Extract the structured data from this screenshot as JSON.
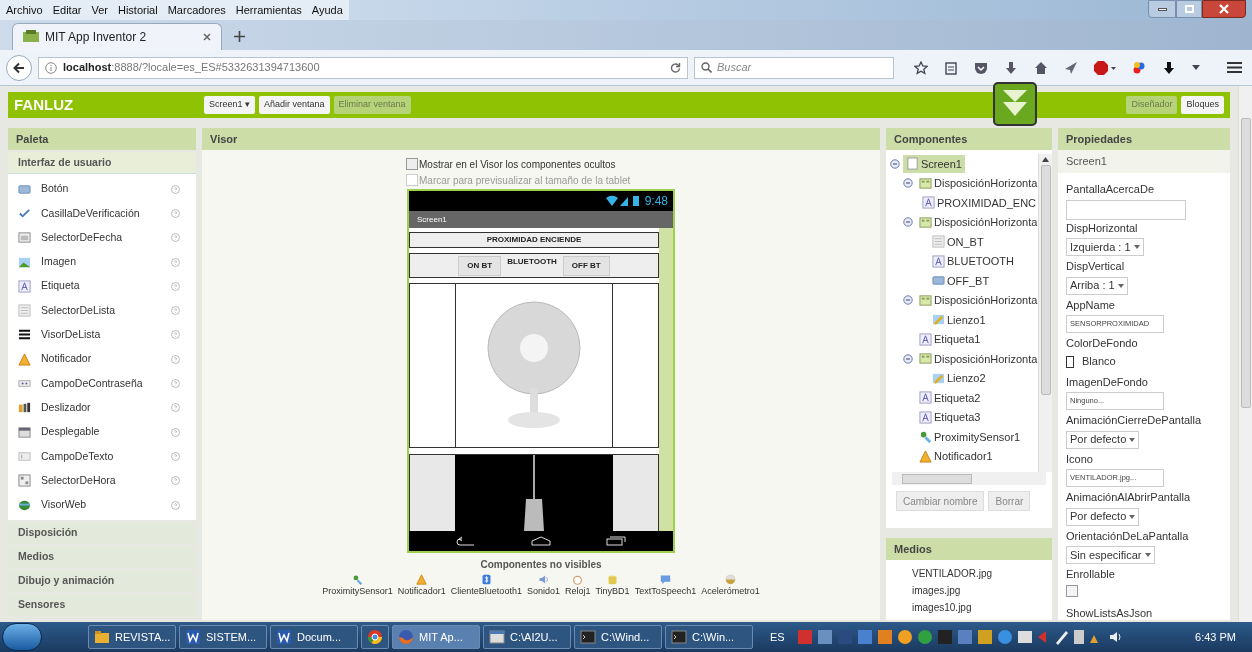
{
  "menu_bar": [
    "Archivo",
    "Editar",
    "Ver",
    "Historial",
    "Marcadores",
    "Herramientas",
    "Ayuda"
  ],
  "browser_tabs": [
    {
      "label": "MIT App Inventor 2",
      "selected": true
    }
  ],
  "address_bar": {
    "url": "**localhost**:8888/?locale=es_ES#5332631394713600"
  },
  "search": {
    "placeholder": "Buscar"
  },
  "app_bar": {
    "project": "FANLUZ",
    "screen_menu": "Screen1 ▾",
    "buttons": [
      {
        "label": "Añadir ventana",
        "disabled": false
      },
      {
        "label": "Eliminar ventana",
        "disabled": true
      }
    ],
    "views": [
      {
        "label": "Diseñador",
        "selected": true
      },
      {
        "label": "Bloques",
        "selected": false
      }
    ]
  },
  "palette": {
    "title": "Paleta",
    "drawers": [
      {
        "label": "Interfaz de usuario",
        "expanded": true,
        "items": [
          {
            "label": "Botón",
            "kind": "button"
          },
          {
            "label": "CasillaDeVerificación",
            "kind": "checkbox"
          },
          {
            "label": "SelectorDeFecha",
            "kind": "date"
          },
          {
            "label": "Imagen",
            "kind": "image"
          },
          {
            "label": "Etiqueta",
            "kind": "label"
          },
          {
            "label": "SelectorDeLista",
            "kind": "listpicker"
          },
          {
            "label": "VisorDeLista",
            "kind": "listview"
          },
          {
            "label": "Notificador",
            "kind": "notifier"
          },
          {
            "label": "CampoDeContraseña",
            "kind": "password"
          },
          {
            "label": "Deslizador",
            "kind": "slider"
          },
          {
            "label": "Desplegable",
            "kind": "spinner"
          },
          {
            "label": "CampoDeTexto",
            "kind": "textbox"
          },
          {
            "label": "SelectorDeHora",
            "kind": "time"
          },
          {
            "label": "VisorWeb",
            "kind": "web"
          }
        ]
      },
      {
        "label": "Disposición",
        "expanded": false
      },
      {
        "label": "Medios",
        "expanded": false
      },
      {
        "label": "Dibujo y animación",
        "expanded": false
      },
      {
        "label": "Sensores",
        "expanded": false
      }
    ]
  },
  "viewer": {
    "title": "Visor",
    "options": [
      {
        "label": "Mostrar en el Visor los componentes ocultos",
        "checked": false,
        "disabled": false
      },
      {
        "label": "Marcar para previsualizar al tamaño de la tablet",
        "checked": false,
        "disabled": true
      }
    ],
    "phone": {
      "time": "9:48",
      "title": "Screen1",
      "heading": "PROXIMIDAD ENCIENDE",
      "row": [
        {
          "kind": "button",
          "text": "ON BT"
        },
        {
          "kind": "label",
          "text": "BLUETOOTH"
        },
        {
          "kind": "button",
          "text": "OFF BT"
        }
      ]
    },
    "non_visible_title": "Componentes no visibles",
    "non_visible": [
      {
        "label": "ProximitySensor1",
        "kind": "sensor"
      },
      {
        "label": "Notificador1",
        "kind": "notifier"
      },
      {
        "label": "ClienteBluetooth1",
        "kind": "bluetooth"
      },
      {
        "label": "Sonido1",
        "kind": "sound"
      },
      {
        "label": "Reloj1",
        "kind": "clock"
      },
      {
        "label": "TinyBD1",
        "kind": "db"
      },
      {
        "label": "TextToSpeech1",
        "kind": "tts"
      },
      {
        "label": "Acelerómetro1",
        "kind": "accel"
      }
    ]
  },
  "components": {
    "title": "Componentes",
    "tree": [
      {
        "label": "Screen1",
        "kind": "screen",
        "selected": true,
        "expanded": true,
        "children": [
          {
            "label": "DisposiciónHorizonta",
            "kind": "arrangement",
            "selected": false,
            "expanded": true,
            "children": [
              {
                "label": "PROXIMIDAD_ENC",
                "kind": "label",
                "selected": false
              }
            ]
          },
          {
            "label": "DisposiciónHorizonta",
            "kind": "arrangement",
            "selected": false,
            "expanded": true,
            "children": [
              {
                "label": "ON_BT",
                "kind": "listpicker",
                "selected": false
              },
              {
                "label": "BLUETOOTH",
                "kind": "label",
                "selected": false
              },
              {
                "label": "OFF_BT",
                "kind": "button",
                "selected": false
              }
            ]
          },
          {
            "label": "DisposiciónHorizonta",
            "kind": "arrangement",
            "selected": false,
            "expanded": true,
            "children": [
              {
                "label": "Lienzo1",
                "kind": "canvas",
                "selected": false
              }
            ]
          },
          {
            "label": "Etiqueta1",
            "kind": "label",
            "selected": false
          },
          {
            "label": "DisposiciónHorizonta",
            "kind": "arrangement",
            "selected": false,
            "expanded": true,
            "children": [
              {
                "label": "Lienzo2",
                "kind": "canvas",
                "selected": false
              }
            ]
          },
          {
            "label": "Etiqueta2",
            "kind": "label",
            "selected": false
          },
          {
            "label": "Etiqueta3",
            "kind": "label",
            "selected": false
          },
          {
            "label": "ProximitySensor1",
            "kind": "sensor",
            "selected": false
          },
          {
            "label": "Notificador1",
            "kind": "notifier",
            "selected": false
          }
        ]
      }
    ],
    "buttons": [
      "Cambiar nombre",
      "Borrar"
    ]
  },
  "media": {
    "title": "Medios",
    "files": [
      "VENTILADOR.jpg",
      "images.jpg",
      "images10.jpg"
    ]
  },
  "properties": {
    "title": "Propiedades",
    "component": "Screen1",
    "items": [
      {
        "label": "PantallaAcercaDe",
        "kind": "textarea"
      },
      {
        "label": "DispHorizontal",
        "kind": "select",
        "value": "Izquierda : 1"
      },
      {
        "label": "DispVertical",
        "kind": "select",
        "value": "Arriba : 1"
      },
      {
        "label": "AppName",
        "kind": "text",
        "value": "SENSORPROXIMIDAD"
      },
      {
        "label": "ColorDeFondo",
        "kind": "color",
        "value": "Blanco",
        "color": "#ffffff"
      },
      {
        "label": "ImagenDeFondo",
        "kind": "text",
        "value": "Ninguno..."
      },
      {
        "label": "AnimaciónCierreDePantalla",
        "kind": "select",
        "value": "Por defecto"
      },
      {
        "label": "Icono",
        "kind": "text",
        "value": "VENTILADOR.jpg..."
      },
      {
        "label": "AnimaciónAlAbrirPantalla",
        "kind": "select",
        "value": "Por defecto"
      },
      {
        "label": "OrientaciónDeLaPantalla",
        "kind": "select",
        "value": "Sin especificar"
      },
      {
        "label": "Enrollable",
        "kind": "checkbox",
        "checked": false
      },
      {
        "label": "ShowListsAsJson",
        "kind": "label_only"
      }
    ]
  },
  "taskbar": {
    "windows": [
      {
        "label": "REVISTA...",
        "kind": "folder",
        "selected": false
      },
      {
        "label": "SISTEM...",
        "kind": "word",
        "selected": false
      },
      {
        "label": "Docum...",
        "kind": "word",
        "selected": false
      },
      {
        "kind": "chrome",
        "selected": false
      },
      {
        "label": "MIT Ap...",
        "kind": "firefox",
        "selected": true
      },
      {
        "label": "C:\\AI2U...",
        "kind": "window",
        "selected": false
      },
      {
        "label": "C:\\Wind...",
        "kind": "console",
        "selected": false
      },
      {
        "label": "C:\\Win...",
        "kind": "console",
        "selected": false
      }
    ],
    "language": "ES",
    "clock": "6:43 PM"
  }
}
